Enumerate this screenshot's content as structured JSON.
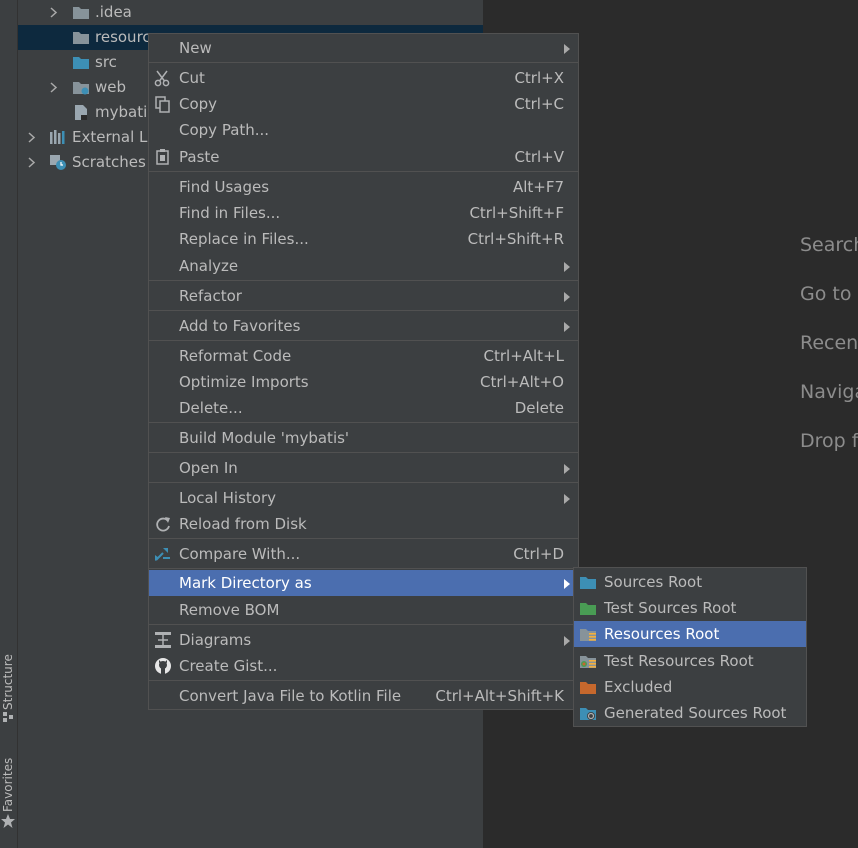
{
  "tool_strip": {
    "structure_label": "Structure",
    "favorites_label": "Favorites"
  },
  "project_tree": {
    "rows": [
      {
        "label": ".idea",
        "icon": "folder-icon"
      },
      {
        "label": "resourc",
        "icon": "folder-icon",
        "selected": true
      },
      {
        "label": "src",
        "icon": "source-folder-icon"
      },
      {
        "label": "web",
        "icon": "web-folder-icon"
      },
      {
        "label": "mybatis",
        "icon": "module-file-icon"
      },
      {
        "label": "External Li",
        "icon": "library-icon"
      },
      {
        "label": "Scratches a",
        "icon": "scratches-icon"
      }
    ]
  },
  "editor_hints": [
    "Search",
    "Go to",
    "Recent",
    "Naviga",
    "Drop f"
  ],
  "context_menu": {
    "items": [
      {
        "label": "New",
        "shortcut": "",
        "submenu": true,
        "icon": ""
      },
      {
        "label": "Cut",
        "shortcut": "Ctrl+X",
        "icon": "scissors-icon"
      },
      {
        "label": "Copy",
        "shortcut": "Ctrl+C",
        "icon": "copy-icon"
      },
      {
        "label": "Copy Path...",
        "shortcut": "",
        "icon": ""
      },
      {
        "label": "Paste",
        "shortcut": "Ctrl+V",
        "icon": "clipboard-icon"
      },
      {
        "label": "Find Usages",
        "shortcut": "Alt+F7",
        "icon": ""
      },
      {
        "label": "Find in Files...",
        "shortcut": "Ctrl+Shift+F",
        "icon": ""
      },
      {
        "label": "Replace in Files...",
        "shortcut": "Ctrl+Shift+R",
        "icon": ""
      },
      {
        "label": "Analyze",
        "shortcut": "",
        "submenu": true,
        "icon": ""
      },
      {
        "label": "Refactor",
        "shortcut": "",
        "submenu": true,
        "icon": ""
      },
      {
        "label": "Add to Favorites",
        "shortcut": "",
        "submenu": true,
        "icon": ""
      },
      {
        "label": "Reformat Code",
        "shortcut": "Ctrl+Alt+L",
        "icon": ""
      },
      {
        "label": "Optimize Imports",
        "shortcut": "Ctrl+Alt+O",
        "icon": ""
      },
      {
        "label": "Delete...",
        "shortcut": "Delete",
        "icon": ""
      },
      {
        "label": "Build Module 'mybatis'",
        "shortcut": "",
        "icon": ""
      },
      {
        "label": "Open In",
        "shortcut": "",
        "submenu": true,
        "icon": ""
      },
      {
        "label": "Local History",
        "shortcut": "",
        "submenu": true,
        "icon": ""
      },
      {
        "label": "Reload from Disk",
        "shortcut": "",
        "icon": "reload-icon"
      },
      {
        "label": "Compare With...",
        "shortcut": "Ctrl+D",
        "icon": "compare-icon"
      },
      {
        "label": "Mark Directory as",
        "shortcut": "",
        "submenu": true,
        "active": true,
        "icon": ""
      },
      {
        "label": "Remove BOM",
        "shortcut": "",
        "icon": ""
      },
      {
        "label": "Diagrams",
        "shortcut": "",
        "submenu": true,
        "icon": "diagram-icon"
      },
      {
        "label": "Create Gist...",
        "shortcut": "",
        "icon": "github-icon"
      },
      {
        "label": "Convert Java File to Kotlin File",
        "shortcut": "Ctrl+Alt+Shift+K",
        "icon": ""
      }
    ]
  },
  "mark_directory_submenu": {
    "items": [
      {
        "label": "Sources Root",
        "icon": "sources-root-icon"
      },
      {
        "label": "Test Sources Root",
        "icon": "test-sources-root-icon"
      },
      {
        "label": "Resources Root",
        "icon": "resources-root-icon",
        "active": true
      },
      {
        "label": "Test Resources Root",
        "icon": "test-resources-root-icon"
      },
      {
        "label": "Excluded",
        "icon": "excluded-icon"
      },
      {
        "label": "Generated Sources Root",
        "icon": "generated-sources-root-icon"
      }
    ]
  },
  "colors": {
    "menu_bg": "#3c3f41",
    "menu_highlight": "#4b6eaf",
    "tree_selection": "#0d293e",
    "editor_bg": "#2b2b2b",
    "sources_folder": "#3d8fb5",
    "test_folder": "#499c54",
    "excluded_folder": "#c6682d"
  }
}
